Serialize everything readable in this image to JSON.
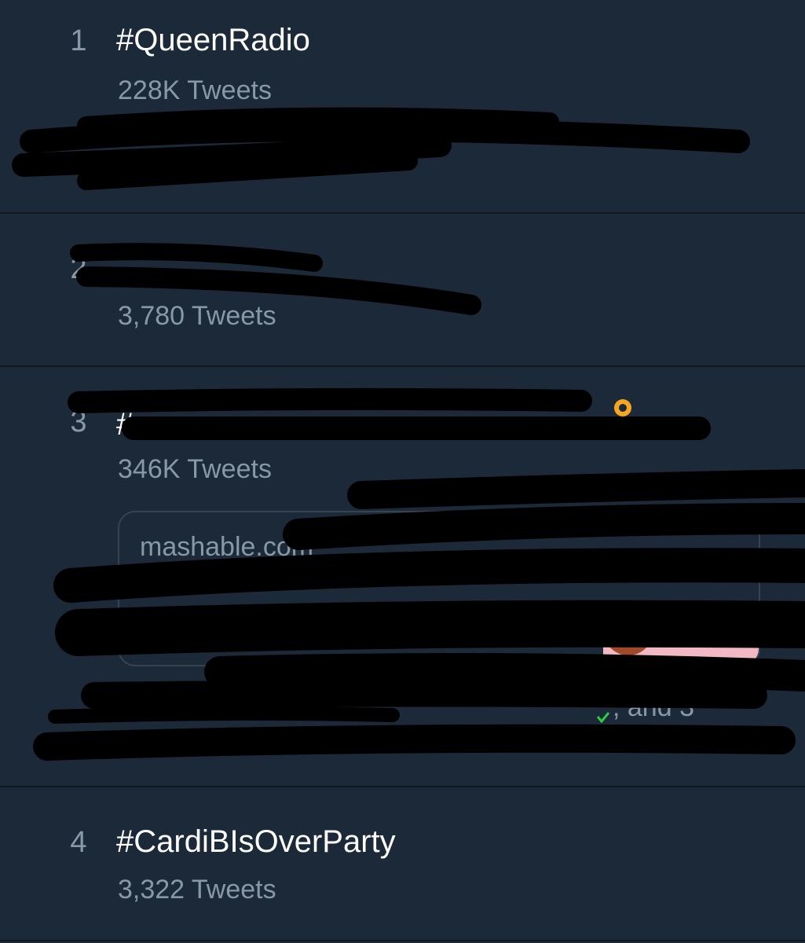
{
  "trends": [
    {
      "rank": "1",
      "name": "#QueenRadio",
      "count": "228K Tweets"
    },
    {
      "rank": "2",
      "name": "",
      "count": "3,780 Tweets"
    },
    {
      "rank": "3",
      "name": "#",
      "count": "346K Tweets"
    },
    {
      "rank": "4",
      "name": "#CardiBIsOverParty",
      "count": "3,322 Tweets"
    }
  ],
  "card": {
    "domain": "mashable.com",
    "trailing_text": ", and 3"
  },
  "colors": {
    "background": "#1c2938",
    "divider": "#10171e",
    "primary_text": "#ffffff",
    "secondary_text": "#8899a6",
    "redaction": "#000000"
  },
  "icons": [
    "location-pin-icon",
    "verified-check-icon"
  ]
}
